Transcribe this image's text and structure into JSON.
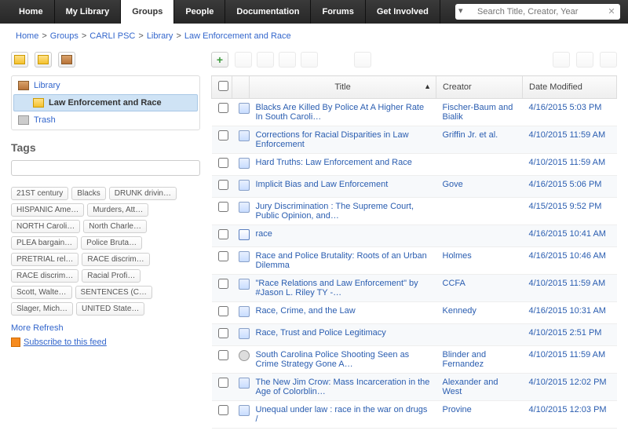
{
  "nav": {
    "tabs": [
      "Home",
      "My Library",
      "Groups",
      "People",
      "Documentation",
      "Forums",
      "Get Involved"
    ],
    "active": 2
  },
  "search": {
    "placeholder": "Search Title, Creator, Year"
  },
  "breadcrumbs": [
    "Home",
    "Groups",
    "CARLI PSC",
    "Library",
    "Law Enforcement and Race"
  ],
  "tree": {
    "library_label": "Library",
    "folder_label": "Law Enforcement and Race",
    "trash_label": "Trash"
  },
  "tags_heading": "Tags",
  "tags": [
    "21ST century",
    "Blacks",
    "DRUNK drivin…",
    "HISPANIC Ame…",
    "Murders, Att…",
    "NORTH Caroli…",
    "North Charle…",
    "PLEA bargain…",
    "Police Bruta…",
    "PRETRIAL rel…",
    "RACE discrim…",
    "RACE discrim…",
    "Racial Profi…",
    "Scott, Walte…",
    "SENTENCES (C…",
    "Slager, Mich…",
    "UNITED State…"
  ],
  "more_label": "More",
  "refresh_label": "Refresh",
  "rss_label": "Subscribe to this feed",
  "columns": {
    "title": "Title",
    "creator": "Creator",
    "date": "Date Modified"
  },
  "items": [
    {
      "type": "doc",
      "title": "Blacks Are Killed By Police At A Higher Rate In South Caroli…",
      "creator": "Fischer-Baum and Bialik",
      "date": "4/16/2015 5:03 PM"
    },
    {
      "type": "doc",
      "title": "Corrections for Racial Disparities in Law Enforcement",
      "creator": "Griffin Jr. et al.",
      "date": "4/10/2015 11:59 AM"
    },
    {
      "type": "doc",
      "title": "Hard Truths: Law Enforcement and Race",
      "creator": "",
      "date": "4/10/2015 11:59 AM"
    },
    {
      "type": "doc",
      "title": "Implicit Bias and Law Enforcement",
      "creator": "Gove",
      "date": "4/16/2015 5:06 PM"
    },
    {
      "type": "doc",
      "title": "Jury Discrimination : The Supreme Court, Public Opinion, and…",
      "creator": "",
      "date": "4/15/2015 9:52 PM"
    },
    {
      "type": "book",
      "title": "race",
      "creator": "",
      "date": "4/16/2015 10:41 AM"
    },
    {
      "type": "doc",
      "title": "Race and Police Brutality: Roots of an Urban Dilemma",
      "creator": "Holmes",
      "date": "4/16/2015 10:46 AM"
    },
    {
      "type": "doc",
      "title": "\"Race Relations and Law Enforcement\" by #Jason L. Riley TY -…",
      "creator": "CCFA",
      "date": "4/10/2015 11:59 AM"
    },
    {
      "type": "doc",
      "title": "Race, Crime, and the Law",
      "creator": "Kennedy",
      "date": "4/16/2015 10:31 AM"
    },
    {
      "type": "doc",
      "title": "Race, Trust and Police Legitimacy",
      "creator": "",
      "date": "4/10/2015 2:51 PM"
    },
    {
      "type": "other",
      "title": "South Carolina Police Shooting Seen as Crime Strategy Gone A…",
      "creator": "Blinder and Fernandez",
      "date": "4/10/2015 11:59 AM"
    },
    {
      "type": "doc",
      "title": "The New Jim Crow: Mass Incarceration in the Age of Colorblin…",
      "creator": "Alexander and West",
      "date": "4/10/2015 12:02 PM"
    },
    {
      "type": "doc",
      "title": "Unequal under law : race in the war on drugs /",
      "creator": "Provine",
      "date": "4/10/2015 12:03 PM"
    }
  ]
}
